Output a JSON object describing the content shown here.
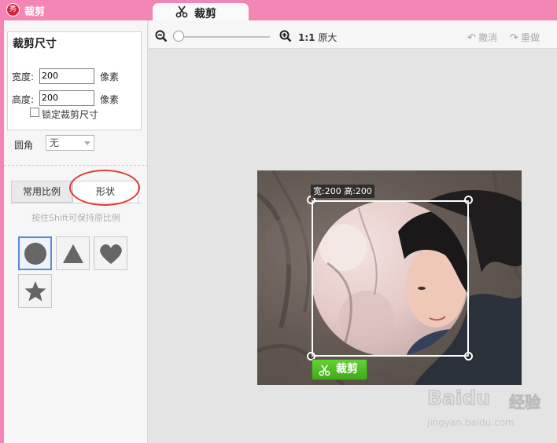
{
  "window": {
    "app_logo_text": "秀",
    "app_title": "裁剪",
    "tab_title": "裁剪"
  },
  "sidebar": {
    "size_section_title": "裁剪尺寸",
    "width_label": "宽度:",
    "width_value": "200",
    "width_unit": "像素",
    "height_label": "高度:",
    "height_value": "200",
    "height_unit": "像素",
    "lock_label": "锁定裁剪尺寸",
    "lock_checked": false,
    "corner_label": "圆角",
    "corner_value": "无",
    "tabs": [
      {
        "label": "常用比例",
        "active": false
      },
      {
        "label": "形状",
        "active": true
      }
    ],
    "hint": "按住Shift可保持原比例",
    "shapes": [
      {
        "name": "circle",
        "selected": true
      },
      {
        "name": "triangle",
        "selected": false
      },
      {
        "name": "heart",
        "selected": false
      },
      {
        "name": "star",
        "selected": false
      }
    ]
  },
  "toolbar": {
    "zoom_ratio": "1:1",
    "zoom_label": "原大",
    "undo_label": "撤消",
    "redo_label": "重做"
  },
  "canvas": {
    "size_readout": "宽:200 高:200",
    "crop_button_label": "裁剪"
  },
  "watermark": {
    "brand": "Baidu",
    "brand_cn": "经验",
    "url": "jingyan.baidu.com"
  },
  "colors": {
    "title_bar": "#f386b4",
    "crop_button": "#4cbd23",
    "annotation_circle": "#e03a3a",
    "selected_shape_border": "#5b8ad0"
  }
}
